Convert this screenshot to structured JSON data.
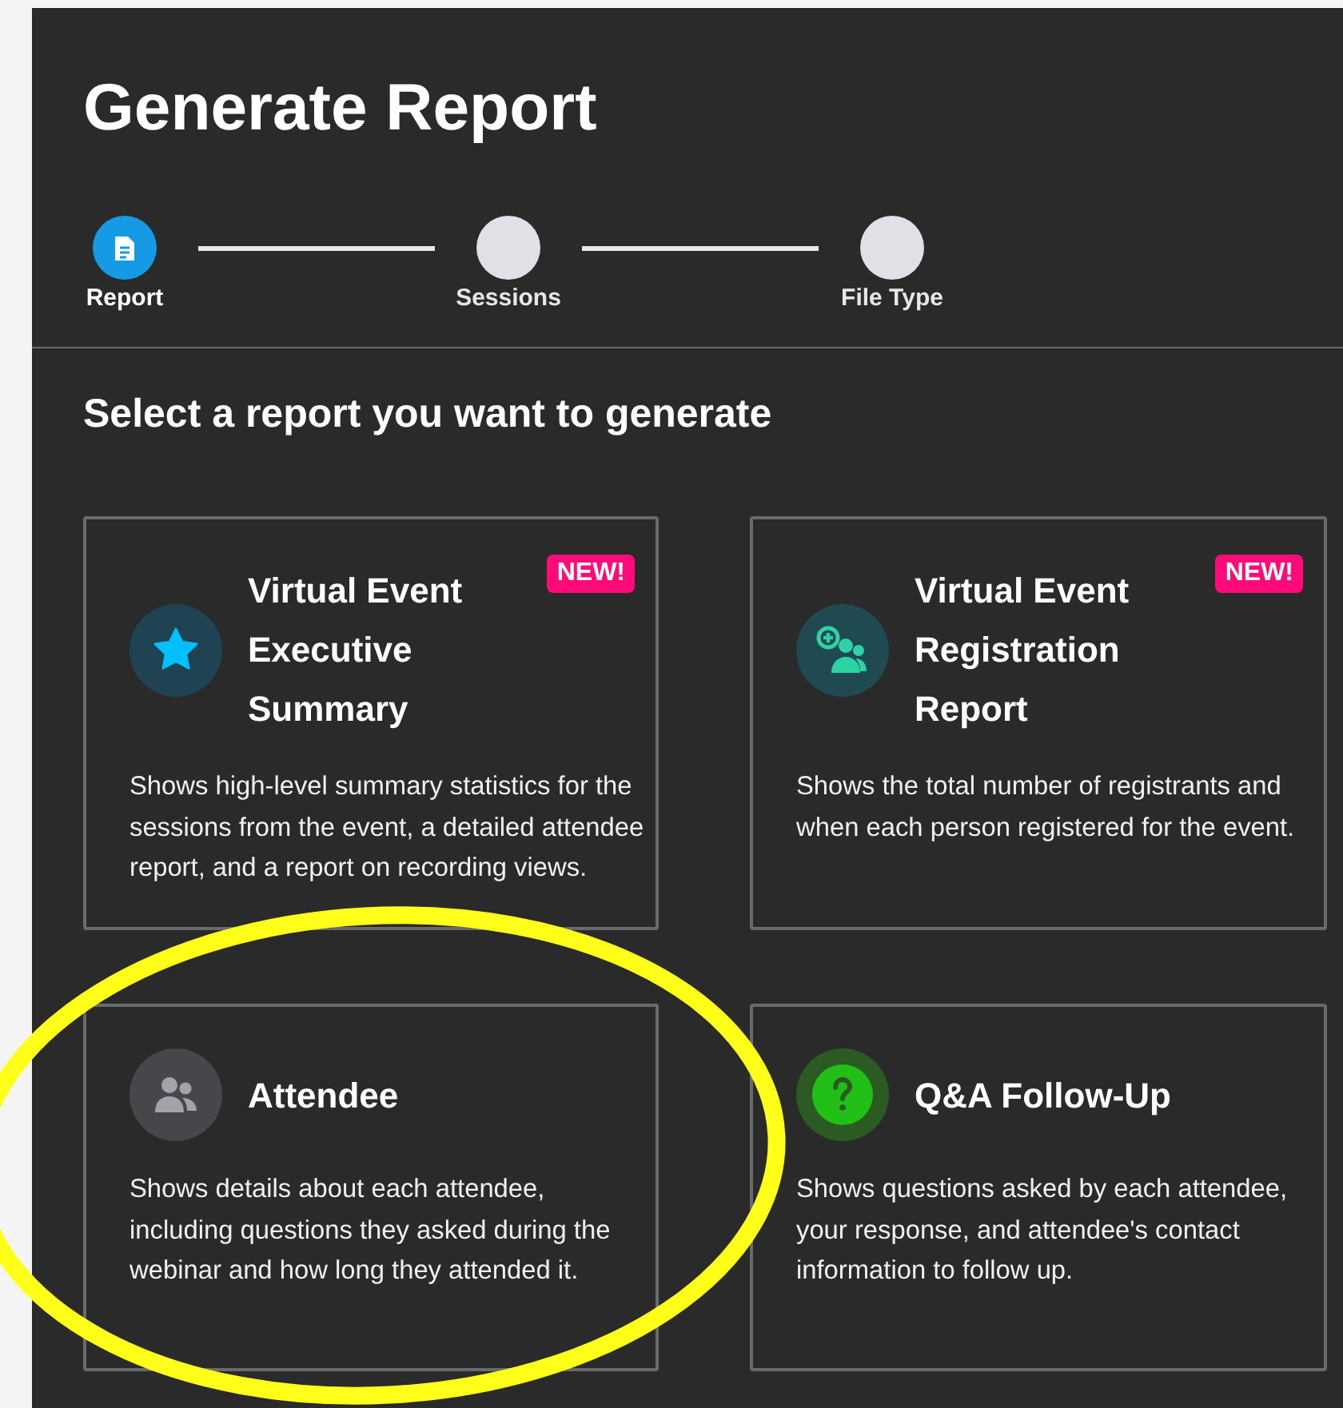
{
  "title": "Generate Report",
  "steps": [
    {
      "label": "Report",
      "selected": true
    },
    {
      "label": "Sessions",
      "selected": false
    },
    {
      "label": "File Type",
      "selected": false
    }
  ],
  "subtitle": "Select a report you want to generate",
  "cards": [
    {
      "kind": "star",
      "title": "Virtual Event Executive Summary",
      "badge": "NEW!",
      "description": "Shows high-level summary statistics for the sessions from the event, a detailed attendee report, and a report on recording views."
    },
    {
      "kind": "registration",
      "title": "Virtual Event Registration Report",
      "badge": "NEW!",
      "description": "Shows the total number of registrants and when each person registered for the event."
    },
    {
      "kind": "attendee",
      "title": "Attendee",
      "description": "Shows details about each attendee, including questions they asked during the webinar and how long they attended it."
    },
    {
      "kind": "qa",
      "title": "Q&A Follow-Up",
      "description": "Shows questions asked by each attendee, your response, and attendee's contact information to follow up."
    }
  ]
}
